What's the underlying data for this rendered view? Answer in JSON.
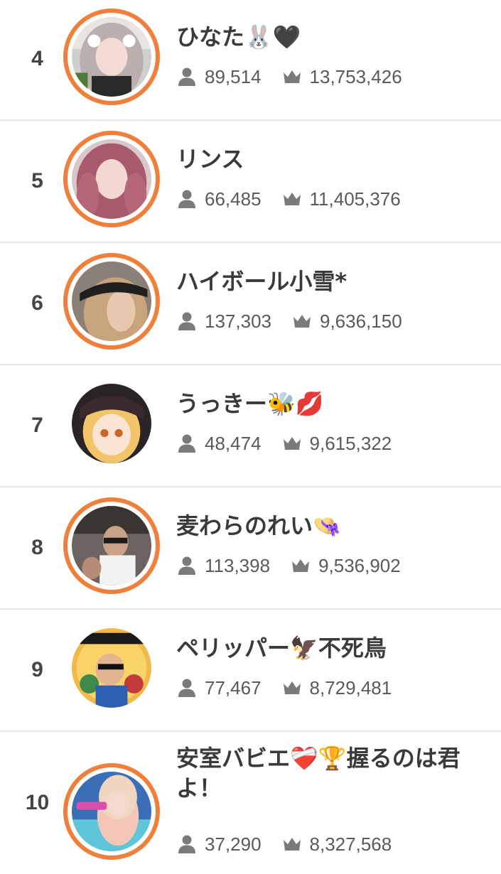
{
  "ranking": [
    {
      "rank": "4",
      "name": "ひなた🐰🖤",
      "followers": "89,514",
      "points": "13,753,426",
      "ring": true,
      "avatar": "avatar-girl-silver-hair"
    },
    {
      "rank": "5",
      "name": "リンス",
      "followers": "66,485",
      "points": "11,405,376",
      "ring": true,
      "avatar": "avatar-girl-pink-hair"
    },
    {
      "rank": "6",
      "name": "ハイボール小雪*",
      "followers": "137,303",
      "points": "9,636,150",
      "ring": true,
      "avatar": "avatar-girl-cap"
    },
    {
      "rank": "7",
      "name": "うっきー🐝💋",
      "followers": "48,474",
      "points": "9,615,322",
      "ring": false,
      "avatar": "avatar-anime-girl"
    },
    {
      "rank": "8",
      "name": "麦わらのれい👒",
      "followers": "113,398",
      "points": "9,536,902",
      "ring": true,
      "avatar": "avatar-man-sunglasses"
    },
    {
      "rank": "9",
      "name": "ペリッパー🦅不死鳥",
      "followers": "77,467",
      "points": "8,729,481",
      "ring": false,
      "avatar": "avatar-illustration"
    },
    {
      "rank": "10",
      "name": "安室バビエ❤️‍🩹🏆握るのは君よ！",
      "followers": "37,290",
      "points": "8,327,568",
      "ring": true,
      "avatar": "avatar-amuro-babie"
    }
  ],
  "colors": {
    "ring": "#ef7f3a",
    "divider": "#e6e6e6",
    "icon": "#7a7a7a",
    "text": "#3a3a3a"
  },
  "icons": {
    "followers": "person-icon",
    "points": "crown-icon"
  }
}
